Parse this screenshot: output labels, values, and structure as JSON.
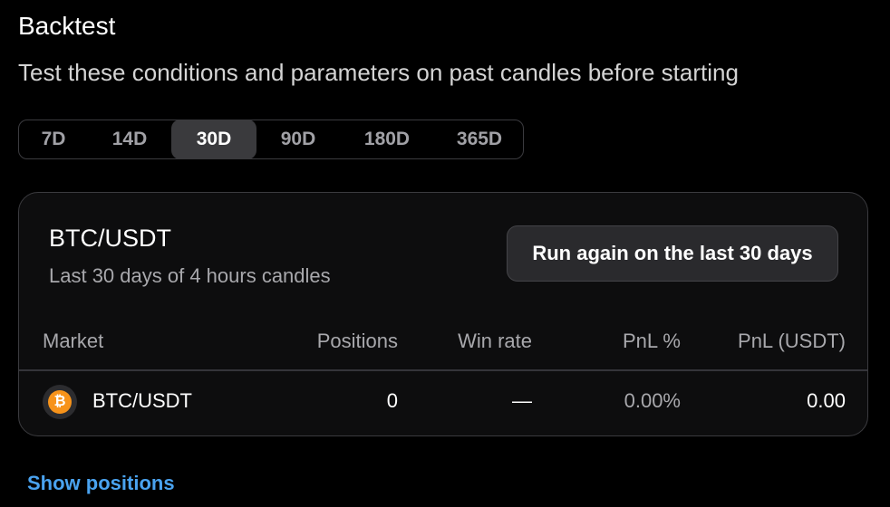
{
  "header": {
    "title": "Backtest",
    "subtitle": "Test these conditions and parameters on past candles before starting"
  },
  "periods": {
    "selected": "30D",
    "options": [
      "7D",
      "14D",
      "30D",
      "90D",
      "180D",
      "365D"
    ]
  },
  "card": {
    "pair": "BTC/USDT",
    "caption": "Last 30 days of 4 hours candles",
    "run_button_label": "Run again on the last 30 days"
  },
  "table": {
    "headers": {
      "market": "Market",
      "positions": "Positions",
      "win_rate": "Win rate",
      "pnl_pct": "PnL %",
      "pnl_usdt": "PnL (USDT)"
    },
    "rows": [
      {
        "coin_icon": "bitcoin-icon",
        "coin_symbol": "₿",
        "market": "BTC/USDT",
        "positions": "0",
        "win_rate": "—",
        "pnl_pct": "0.00%",
        "pnl_usdt": "0.00"
      }
    ]
  },
  "footer": {
    "show_positions_label": "Show positions"
  },
  "colors": {
    "background": "#000000",
    "card_background": "#0d0d0e",
    "border": "#3b3b3f",
    "active_tab": "#3a3a3d",
    "link": "#4aa3f0",
    "bitcoin": "#f7931a",
    "muted_text": "#a8a8ac"
  }
}
